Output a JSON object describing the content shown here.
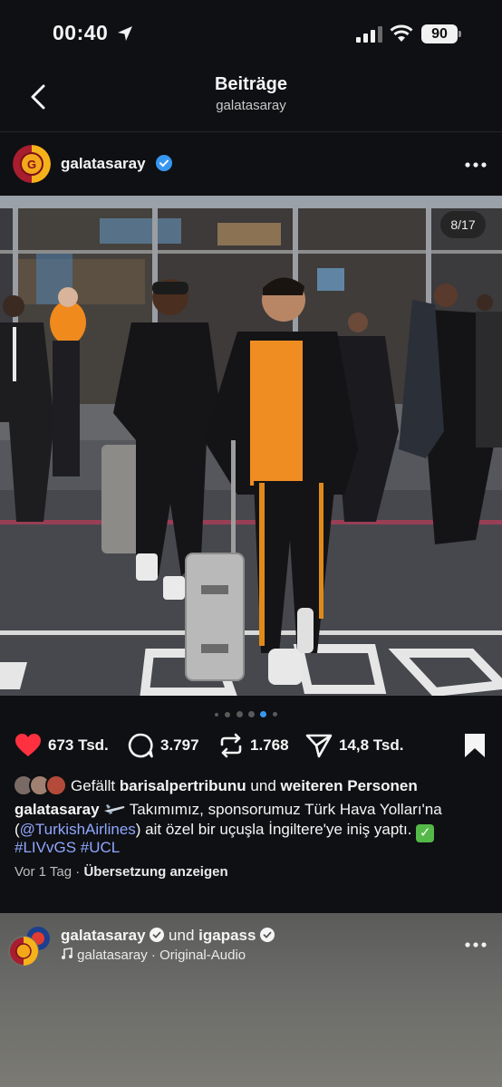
{
  "status_bar": {
    "time": "00:40",
    "battery": "90"
  },
  "header": {
    "title": "Beiträge",
    "subtitle": "galatasaray"
  },
  "post": {
    "author": "galatasaray",
    "image_counter": "8/17",
    "carousel": {
      "current_index": 4,
      "visible_dots": 6
    },
    "likes_count": "673 Tsd.",
    "comments_count": "3.797",
    "reposts_count": "1.768",
    "shares_count": "14,8 Tsd.",
    "liked_by": {
      "prefix": "Gefällt",
      "user": "barisalpertribunu",
      "middle": "und",
      "suffix": "weiteren Personen"
    },
    "caption": {
      "author": "galatasaray",
      "text_line1": "Takımımız, sponsorumuz Türk Hava Yolları'na",
      "mention": "@TurkishAirlines",
      "text_line2": "ait özel bir uçuşla İngiltere'ye iniş yaptı.",
      "hashtags": "#LIVvGS #UCL"
    },
    "time_ago": "Vor 1 Tag",
    "translate_label": "Übersetzung anzeigen"
  },
  "next_post": {
    "author": "galatasaray",
    "joiner": "und",
    "coauthor": "igapass",
    "audio_author": "galatasaray",
    "audio_label": "Original-Audio"
  },
  "colors": {
    "like_red": "#ff3040",
    "verified_blue": "#3797f0",
    "link_blue": "#8fa6ff"
  }
}
